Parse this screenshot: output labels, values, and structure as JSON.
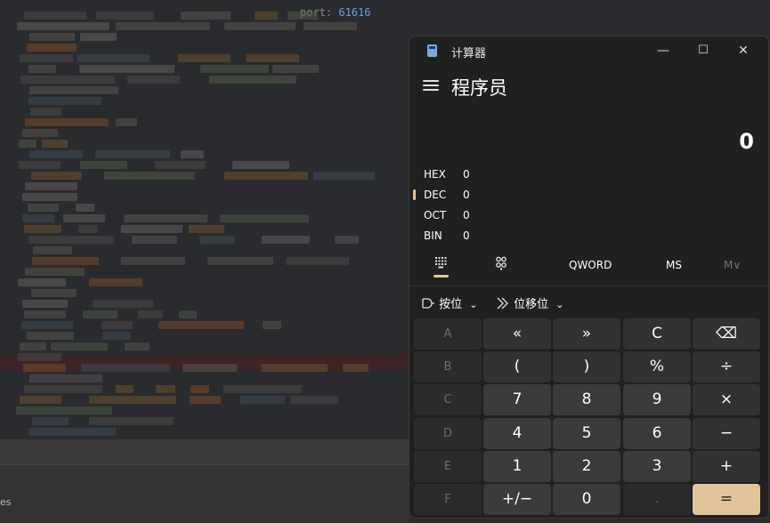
{
  "background": {
    "port_label": "port:",
    "port_value": "61616",
    "bottom_fragment": "es"
  },
  "window": {
    "title": "计算器",
    "minimize": "—",
    "maximize": "☐",
    "close": "✕"
  },
  "mode": "程序员",
  "display": "0",
  "bases": [
    {
      "label": "HEX",
      "value": "0"
    },
    {
      "label": "DEC",
      "value": "0"
    },
    {
      "label": "OCT",
      "value": "0"
    },
    {
      "label": "BIN",
      "value": "0"
    }
  ],
  "tabs": {
    "qword": "QWORD",
    "ms": "MS",
    "mv": "M∨"
  },
  "toolbar": {
    "bitwise": "按位",
    "bitshift": "位移位"
  },
  "keys": [
    [
      "A",
      "«",
      "»",
      "C",
      "⌫"
    ],
    [
      "B",
      "(",
      ")",
      "%",
      "÷"
    ],
    [
      "C",
      "7",
      "8",
      "9",
      "×"
    ],
    [
      "D",
      "4",
      "5",
      "6",
      "−"
    ],
    [
      "E",
      "1",
      "2",
      "3",
      "+"
    ],
    [
      "F",
      "+/−",
      "0",
      ".",
      "="
    ]
  ],
  "accent_color": "#e2c49b"
}
